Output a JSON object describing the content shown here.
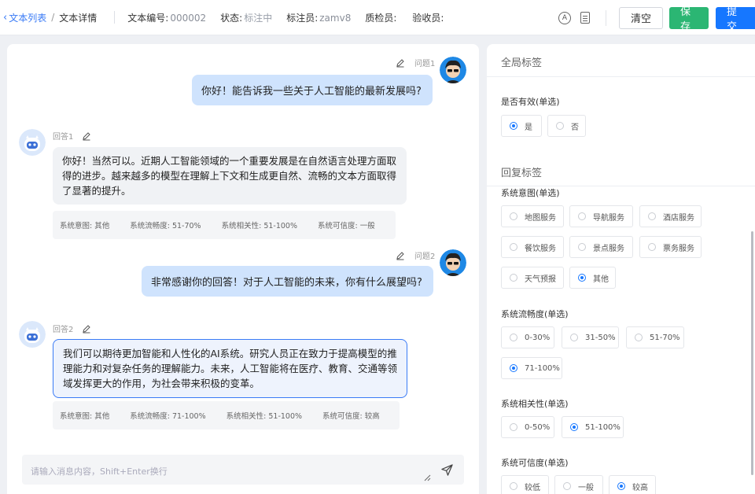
{
  "header": {
    "breadcrumb": {
      "back": "文本列表",
      "sep": "/",
      "current": "文本详情"
    },
    "meta": [
      {
        "label": "文本编号:",
        "value": "000002"
      },
      {
        "label": "状态:",
        "value": "标注中"
      },
      {
        "label": "标注员:",
        "value": "zamv8"
      },
      {
        "label": "质检员:",
        "value": ""
      },
      {
        "label": "验收员:",
        "value": ""
      }
    ],
    "icon_a_letter": "A",
    "buttons": {
      "clear": "清空",
      "save": "保存",
      "submit": "提交"
    },
    "colors": {
      "save": "#2bb673",
      "submit": "#1677ff",
      "link": "#3a7bf6"
    }
  },
  "chat": {
    "turns": [
      {
        "question_label": "问题1",
        "question": "你好！能告诉我一些关于人工智能的最新发展吗?",
        "answer_label": "回答1",
        "answer": "你好！当然可以。近期人工智能领域的一个重要发展是在自然语言处理方面取得的进步。越来越多的模型在理解上下文和生成更自然、流畅的文本方面取得了显著的提升。",
        "tags": [
          "系统意图: 其他",
          "系统流畅度: 51-70%",
          "系统相关性: 51-100%",
          "系统可信度: 一般"
        ]
      },
      {
        "question_label": "问题2",
        "question": "非常感谢你的回答！对于人工智能的未来，你有什么展望吗?",
        "answer_label": "回答2",
        "answer": "我们可以期待更加智能和人性化的AI系统。研究人员正在致力于提高模型的推理能力和对复杂任务的理解能力。未来，人工智能将在医疗、教育、交通等领域发挥更大的作用，为社会带来积极的变革。",
        "tags": [
          "系统意图: 其他",
          "系统流畅度: 71-100%",
          "系统相关性: 51-100%",
          "系统可信度: 较高"
        ]
      }
    ],
    "input_placeholder": "请输入消息内容，Shift+Enter换行"
  },
  "panel": {
    "global_title": "全局标签",
    "valid": {
      "title": "是否有效(单选)",
      "options": [
        "是",
        "否"
      ],
      "selected": "是"
    },
    "reply_title": "回复标签",
    "intent": {
      "title": "系统意图(单选)",
      "options": [
        "地图服务",
        "导航服务",
        "酒店服务",
        "餐饮服务",
        "景点服务",
        "票务服务",
        "天气预报",
        "其他"
      ],
      "selected": "其他"
    },
    "fluency": {
      "title": "系统流畅度(单选)",
      "options": [
        "0-30%",
        "31-50%",
        "51-70%",
        "71-100%"
      ],
      "selected": "71-100%"
    },
    "relevance": {
      "title": "系统相关性(单选)",
      "options": [
        "0-50%",
        "51-100%"
      ],
      "selected": "51-100%"
    },
    "credibility": {
      "title": "系统可信度(单选)",
      "options": [
        "较低",
        "一般",
        "较高"
      ],
      "selected": "较高"
    }
  }
}
